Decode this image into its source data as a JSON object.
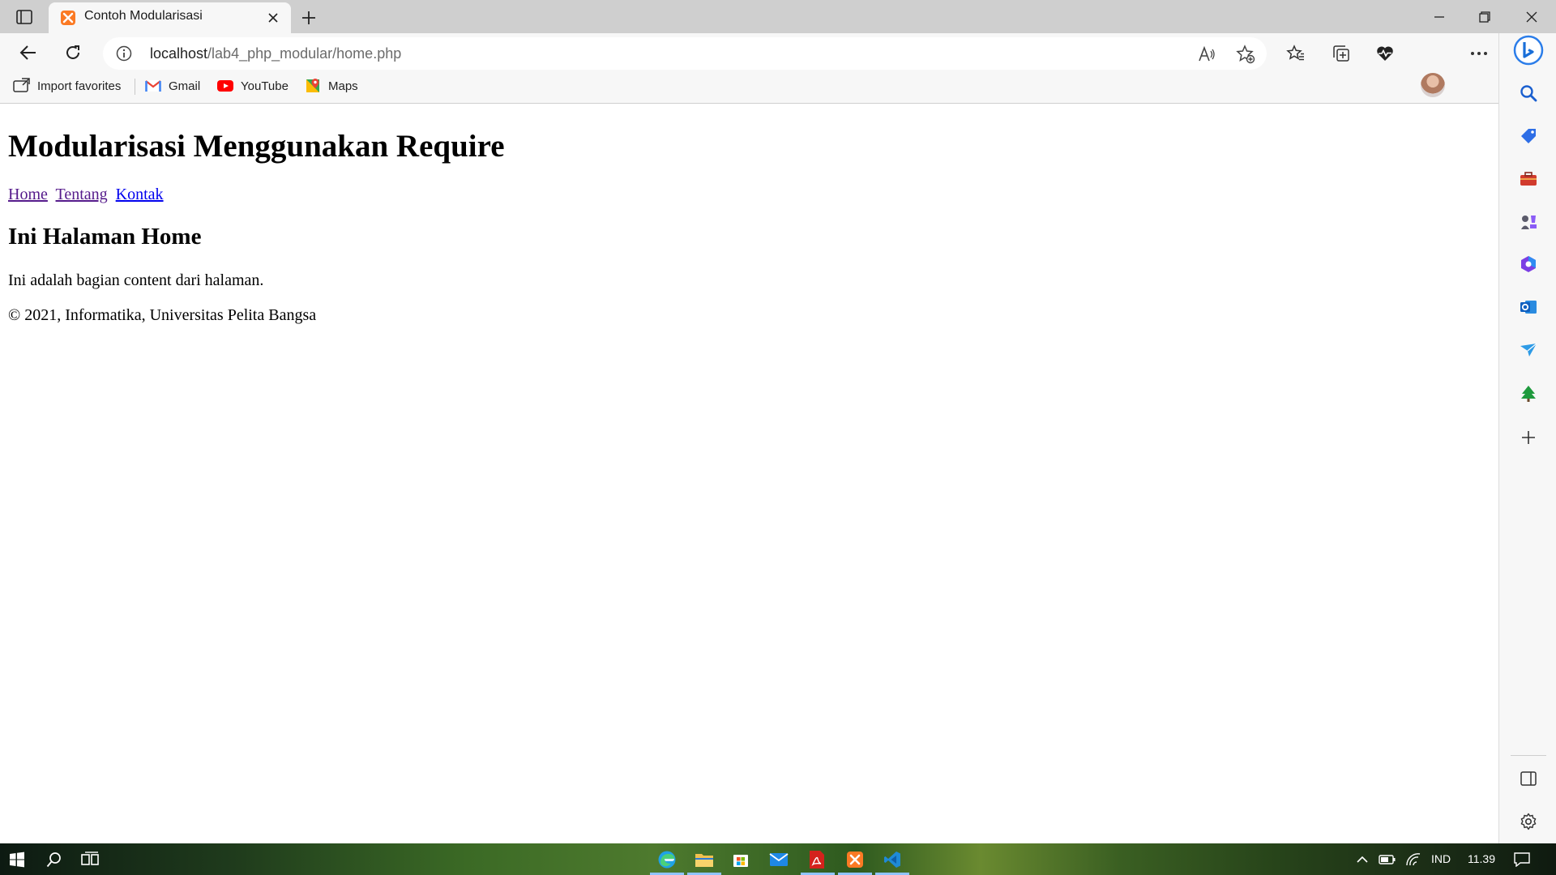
{
  "browser": {
    "tab": {
      "title": "Contoh Modularisasi"
    },
    "address": {
      "host": "localhost",
      "path": "/lab4_php_modular/home.php"
    },
    "bookmarks": [
      {
        "label": "Import favorites",
        "icon": "import-favorites-icon"
      },
      {
        "label": "Gmail",
        "icon": "gmail-icon"
      },
      {
        "label": "YouTube",
        "icon": "youtube-icon"
      },
      {
        "label": "Maps",
        "icon": "maps-icon"
      }
    ]
  },
  "page": {
    "heading": "Modularisasi Menggunakan Require",
    "nav": [
      {
        "label": "Home"
      },
      {
        "label": "Tentang"
      },
      {
        "label": "Kontak"
      }
    ],
    "subheading": "Ini Halaman Home",
    "body_text": "Ini adalah bagian content dari halaman.",
    "footer": "© 2021, Informatika, Universitas Pelita Bangsa"
  },
  "taskbar": {
    "language": "IND",
    "time": "11.39"
  },
  "colors": {
    "link_visited": "#551a8b",
    "link_unvisited": "#0000ee",
    "chrome_bg": "#f7f7f7",
    "titlebar_bg": "#cfcfcf"
  }
}
